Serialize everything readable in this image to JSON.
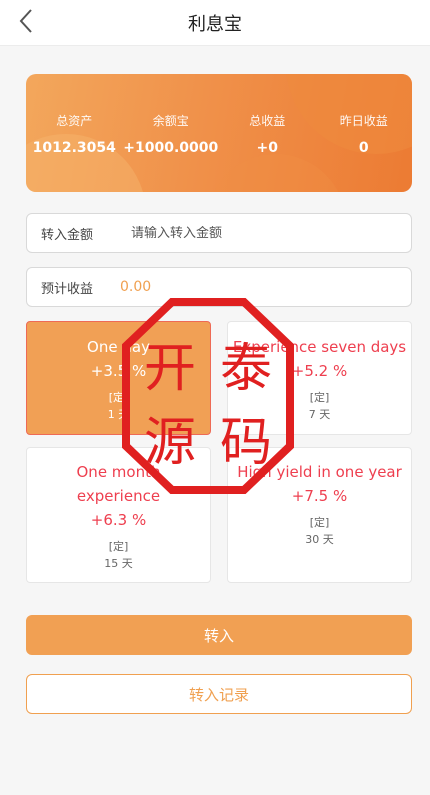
{
  "header": {
    "title": "利息宝"
  },
  "summary": {
    "items": [
      {
        "label": "总资产",
        "value": "1012.3054"
      },
      {
        "label": "余额宝",
        "value": "+1000.0000"
      },
      {
        "label": "总收益",
        "value": "+0"
      },
      {
        "label": "昨日收益",
        "value": "0"
      }
    ]
  },
  "transfer_field": {
    "label": "转入金额",
    "placeholder": "请输入转入金额"
  },
  "estimate_field": {
    "label": "预计收益",
    "value": "0.00"
  },
  "plans": [
    {
      "title": "One day",
      "rate": "+3.5 %",
      "type": "[定]",
      "days": "1 天"
    },
    {
      "title": "Experience seven days",
      "rate": "+5.2 %",
      "type": "[定]",
      "days": "7 天"
    },
    {
      "title": "One month experience",
      "rate": "+6.3 %",
      "type": "[定]",
      "days": "15 天"
    },
    {
      "title": "High yield in one year",
      "rate": "+7.5 %",
      "type": "[定]",
      "days": "30 天"
    }
  ],
  "buttons": {
    "transfer": "转入",
    "records": "转入记录"
  },
  "watermark": {
    "text": [
      "开",
      "泰",
      "源",
      "码"
    ]
  },
  "colors": {
    "accent": "#f1a053",
    "rate_red": "#ee3f4f",
    "stamp_red": "#e02020"
  }
}
